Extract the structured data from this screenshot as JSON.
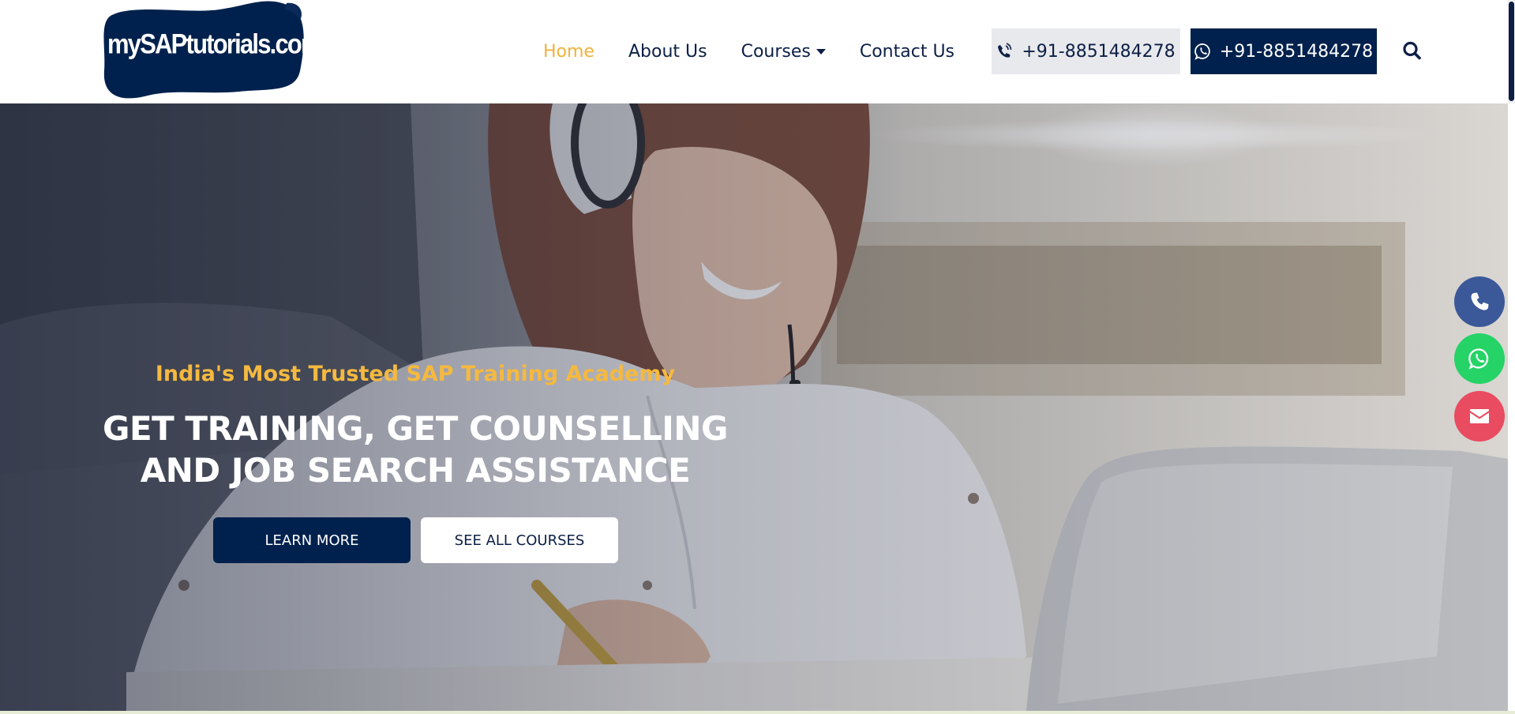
{
  "header": {
    "logo_text": "mySAPtutorials.com",
    "nav": [
      {
        "label": "Home",
        "active": true
      },
      {
        "label": "About Us",
        "active": false
      },
      {
        "label": "Courses",
        "active": false,
        "has_dropdown": true
      },
      {
        "label": "Contact Us",
        "active": false
      }
    ],
    "phone_label": "+91-8851484278",
    "whatsapp_label": "+91-8851484278",
    "icons": {
      "phone": "phone-volume-icon",
      "whatsapp": "whatsapp-icon",
      "search": "search-icon",
      "dropdown": "caret-down-icon"
    }
  },
  "hero": {
    "tagline": "India's Most Trusted SAP Training Academy",
    "title_line1": "GET TRAINING, GET COUNSELLING",
    "title_line2": "AND JOB SEARCH ASSISTANCE",
    "learn_more": "LEARN MORE",
    "see_all_courses": "SEE ALL COURSES"
  },
  "floating": {
    "icons": [
      "phone-icon",
      "whatsapp-icon",
      "envelope-icon"
    ]
  },
  "colors": {
    "navy": "#00214d",
    "accent_gold": "#f0b33b",
    "phone_bg": "#e8e9ec",
    "float_phone": "#3b5998",
    "float_whatsapp": "#25d366",
    "float_mail": "#e94b60"
  }
}
